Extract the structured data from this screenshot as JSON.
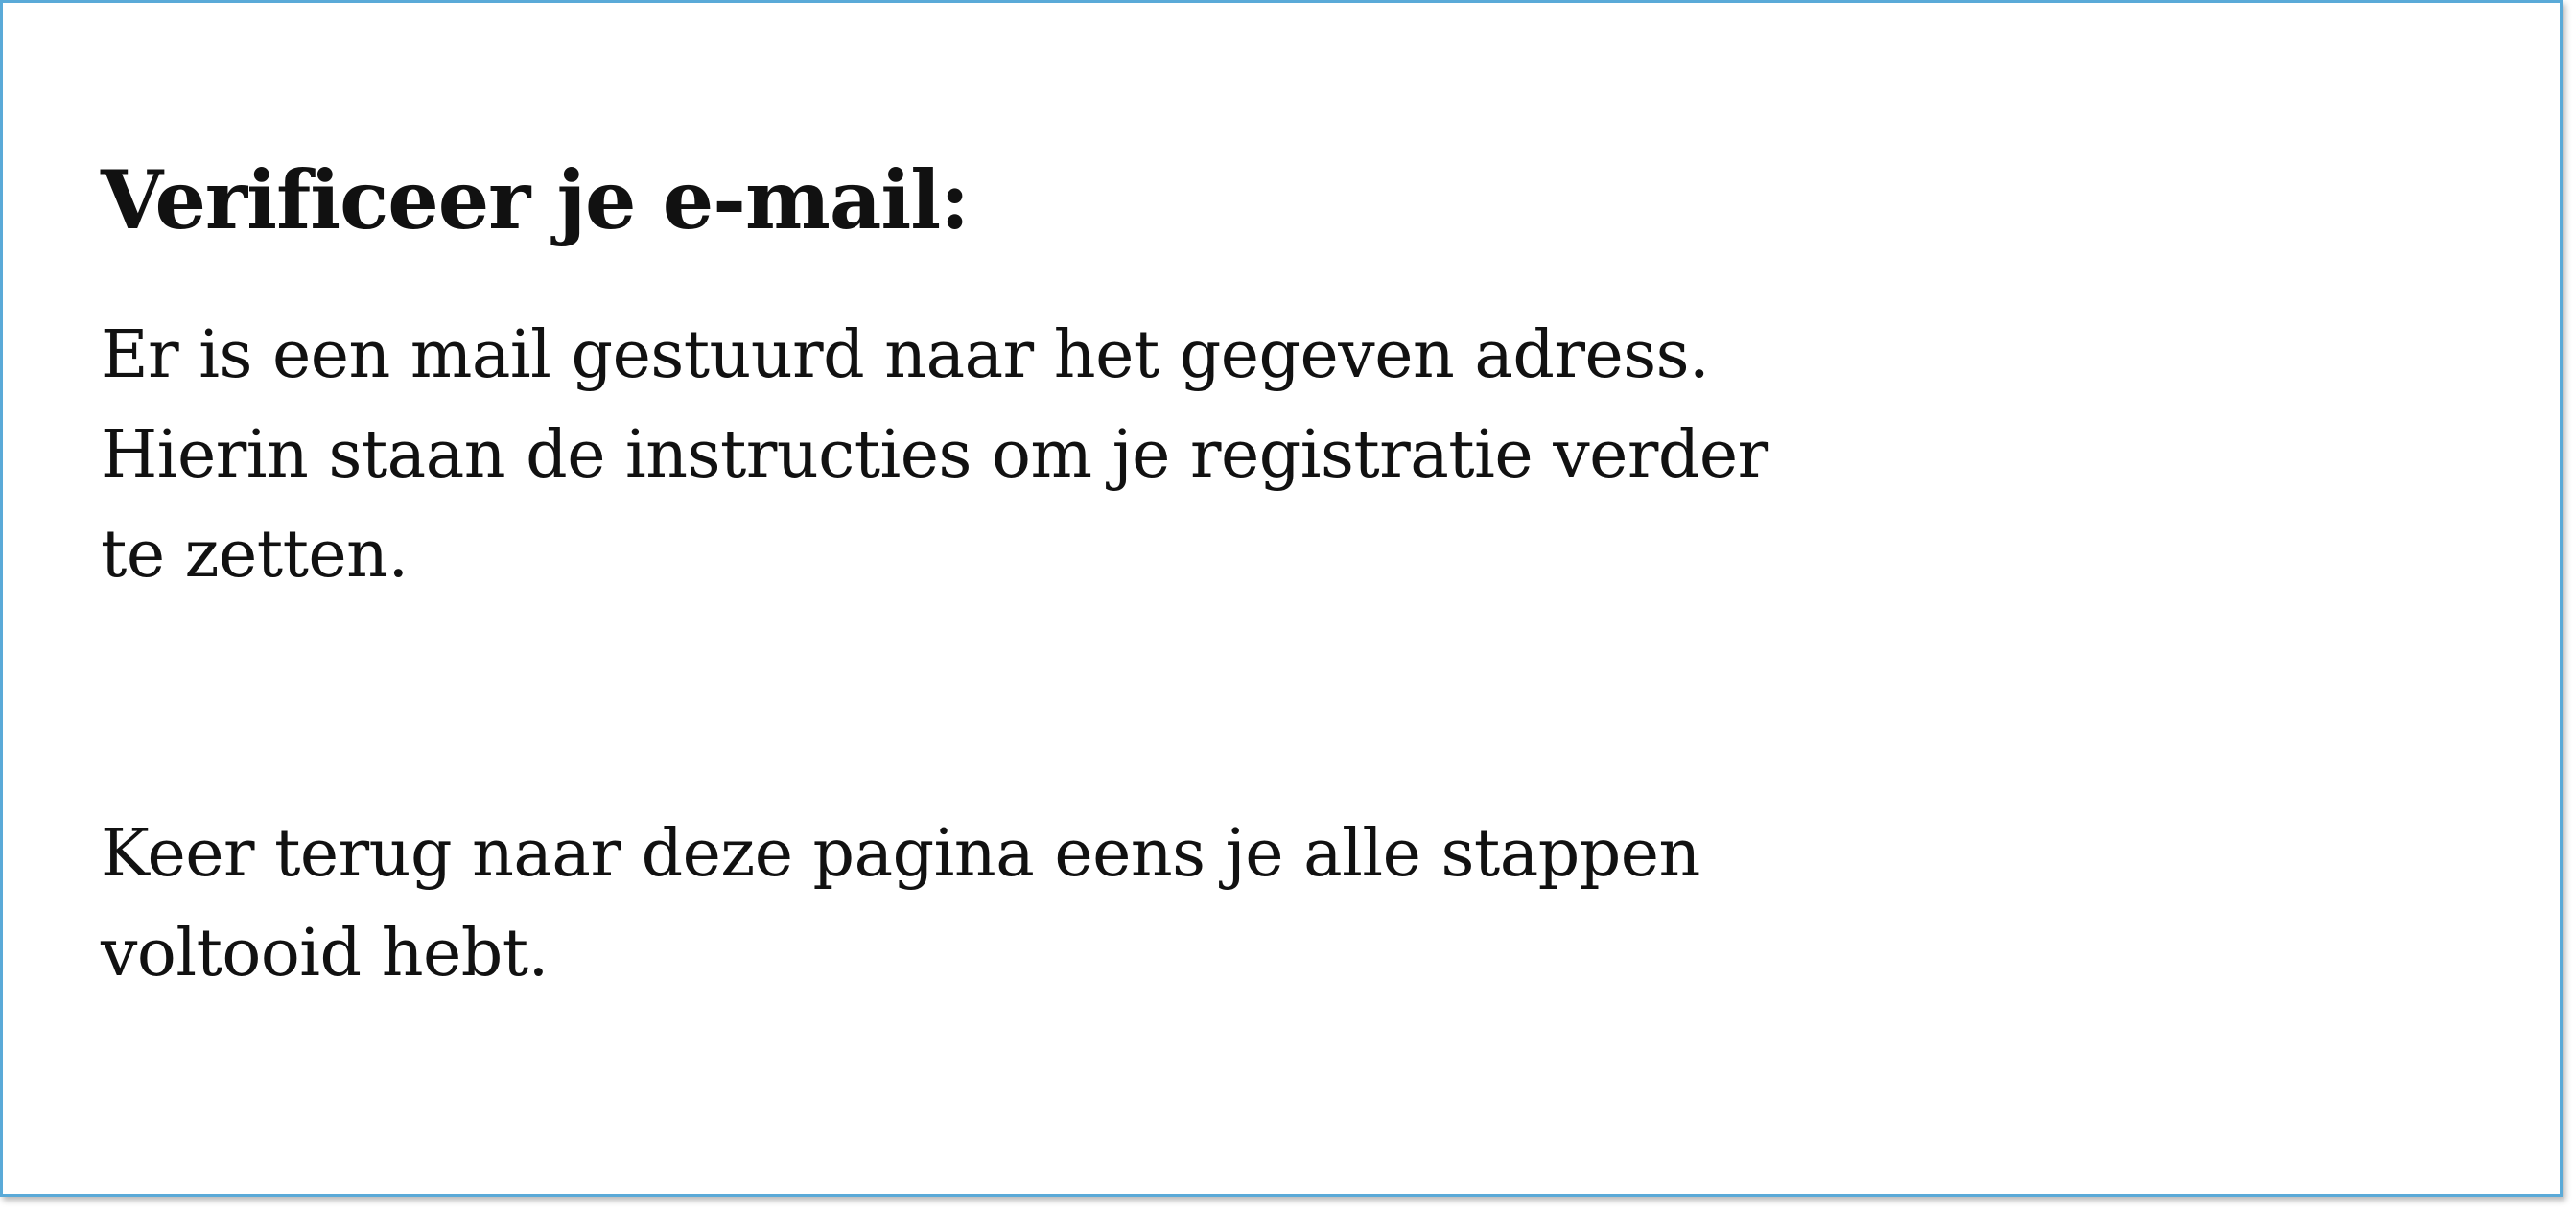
{
  "verification": {
    "title": "Verificeer je e-mail:",
    "message": "Er is een mail gestuurd naar het gegeven adress.\nHierin staan de instructies om je registratie verder\nte zetten.",
    "return_instruction": "Keer terug naar deze pagina eens je alle stappen\nvoltooid hebt."
  },
  "colors": {
    "border": "#5aaad8",
    "background": "#ffffff",
    "text": "#111111"
  }
}
